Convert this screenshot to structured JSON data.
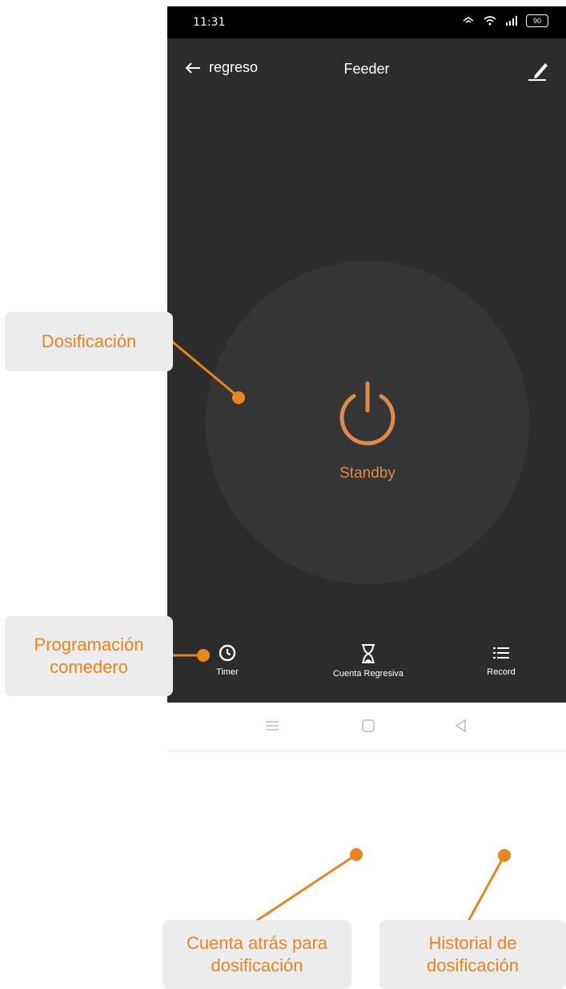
{
  "status_bar": {
    "time": "11:31",
    "battery": "90"
  },
  "header": {
    "back_label": "regreso",
    "title": "Feeder"
  },
  "main": {
    "status_label": "Standby"
  },
  "tabs": [
    {
      "label": "Timer",
      "icon": "clock-icon"
    },
    {
      "label": "Cuenta Regresiva",
      "icon": "hourglass-icon"
    },
    {
      "label": "Record",
      "icon": "list-icon"
    }
  ],
  "nav": [
    "menu-icon",
    "home-icon",
    "back-triangle-icon"
  ],
  "annotations": {
    "dosing": "Dosificación",
    "schedule": [
      "Programación",
      "comedero"
    ],
    "countdown": [
      "Cuenta atrás para",
      "dosificación"
    ],
    "history": [
      "Historial de",
      "dosificación"
    ]
  },
  "colors": {
    "accent": "#e8851f",
    "screen_bg": "#2c2c2c",
    "power": "#e08a4a"
  }
}
